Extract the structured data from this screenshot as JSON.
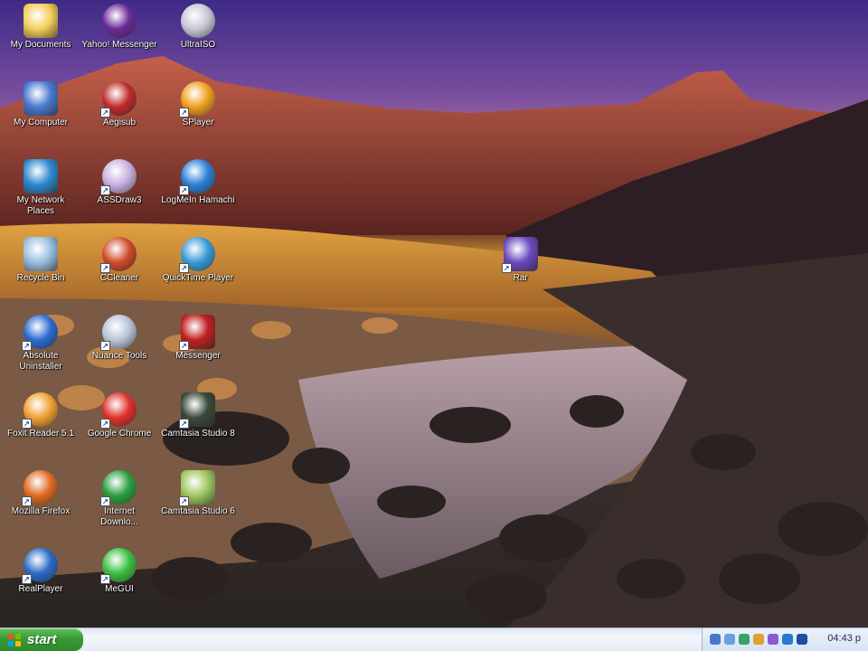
{
  "desktop": {
    "icons": [
      {
        "label": "My Documents",
        "icon": "folder-icon"
      },
      {
        "label": "Yahoo! Messenger",
        "icon": "yahoo-messenger-icon"
      },
      {
        "label": "UltraISO",
        "icon": "disc-icon"
      },
      {
        "label": "My Computer",
        "icon": "computer-icon"
      },
      {
        "label": "Aegisub",
        "icon": "aegisub-icon"
      },
      {
        "label": "SPlayer",
        "icon": "splayer-icon"
      },
      {
        "label": "My Network\nPlaces",
        "icon": "network-icon"
      },
      {
        "label": "ASSDraw3",
        "icon": "assdraw-icon"
      },
      {
        "label": "LogMeIn Hamachi",
        "icon": "hamachi-icon"
      },
      {
        "label": "Recycle Bin",
        "icon": "recycle-bin-icon"
      },
      {
        "label": "CCleaner",
        "icon": "ccleaner-icon"
      },
      {
        "label": "QuickTime Player",
        "icon": "quicktime-icon"
      },
      {
        "label": "Rar",
        "icon": "winrar-icon"
      },
      {
        "label": "Absolute Uninstaller",
        "icon": "uninstaller-icon"
      },
      {
        "label": "Nuance Tools",
        "icon": "tool-icon"
      },
      {
        "label": "Messenger",
        "icon": "messenger-icon"
      },
      {
        "label": "Foxit Reader 5.1",
        "icon": "foxit-icon"
      },
      {
        "label": "Google Chrome",
        "icon": "chrome-icon"
      },
      {
        "label": "Camtasia Studio 8",
        "icon": "camtasia-icon"
      },
      {
        "label": "Mozilla Firefox",
        "icon": "firefox-icon"
      },
      {
        "label": "Internet\nDownlo...",
        "icon": "idm-icon"
      },
      {
        "label": "Camtasia Studio 6",
        "icon": "camtasia6-icon"
      },
      {
        "label": "RealPlayer",
        "icon": "realplayer-icon"
      },
      {
        "label": "MeGUI",
        "icon": "megui-icon"
      }
    ]
  },
  "taskbar": {
    "start_label": "start",
    "clock": "04:43 p"
  }
}
